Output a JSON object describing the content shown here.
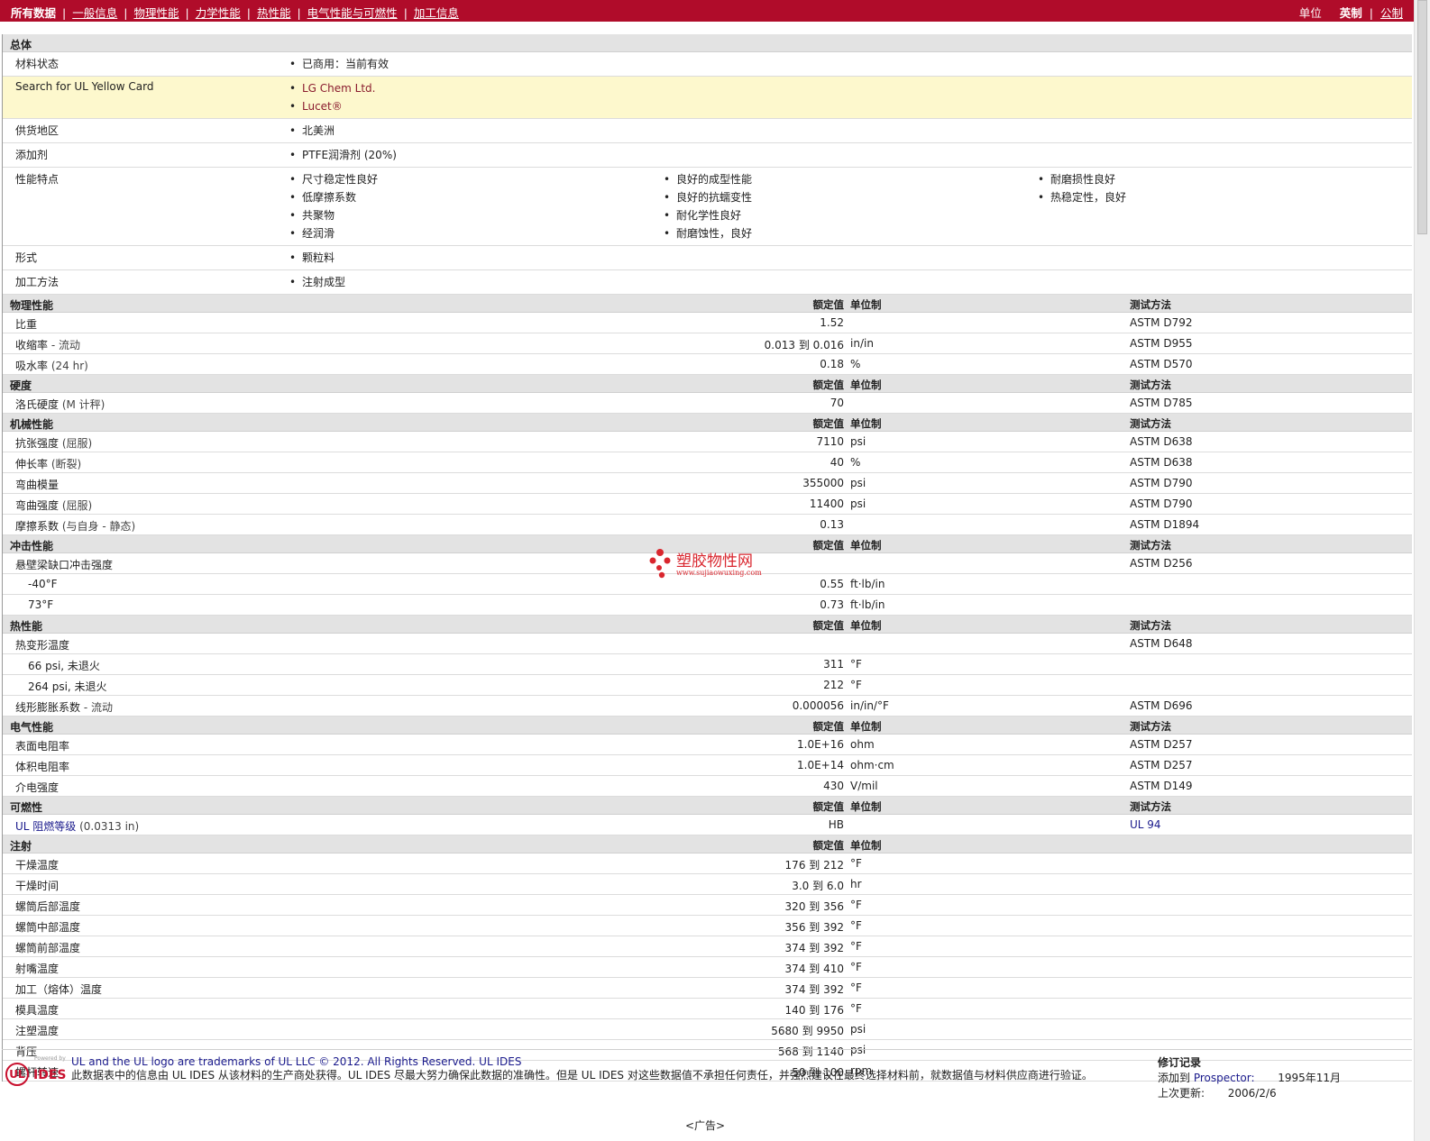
{
  "nav": {
    "tabs": [
      "所有数据",
      "一般信息",
      "物理性能",
      "力学性能",
      "热性能",
      "电气性能与可燃性",
      "加工信息"
    ],
    "units_label": "单位",
    "units": [
      "英制",
      "公制"
    ]
  },
  "general": [
    {
      "label": "总体",
      "type": "section"
    },
    {
      "label": "材料状态",
      "items": [
        [
          "已商用：当前有效"
        ]
      ]
    },
    {
      "label": "Search for UL Yellow Card",
      "highlight": true,
      "link_items": true,
      "items": [
        [
          "LG Chem Ltd.",
          "Lucet®"
        ]
      ]
    },
    {
      "label": "供货地区",
      "items": [
        [
          "北美洲"
        ]
      ]
    },
    {
      "label": "添加剂",
      "items": [
        [
          "PTFE润滑剂 (20%)"
        ]
      ]
    },
    {
      "label": "性能特点",
      "items": [
        [
          "尺寸稳定性良好",
          "低摩擦系数",
          "共聚物",
          "经润滑"
        ],
        [
          "良好的成型性能",
          "良好的抗蠕变性",
          "耐化学性良好",
          "耐磨蚀性，良好"
        ],
        [
          "耐磨损性良好",
          "热稳定性，良好"
        ]
      ]
    },
    {
      "label": "形式",
      "items": [
        [
          "颗粒料"
        ]
      ]
    },
    {
      "label": "加工方法",
      "items": [
        [
          "注射成型"
        ]
      ]
    }
  ],
  "headers": {
    "value": "额定值",
    "unit": "单位制",
    "test": "测试方法"
  },
  "sections": [
    {
      "name": "物理性能",
      "show_test_header": true,
      "rows": [
        {
          "label": "比重",
          "value": "1.52",
          "unit": "",
          "test": "ASTM D792"
        },
        {
          "label": "收缩率",
          "note": " - 流动",
          "value": "0.013 到  0.016",
          "unit": "in/in",
          "test": "ASTM D955"
        },
        {
          "label": "吸水率",
          "note": " (24 hr)",
          "value": "0.18",
          "unit": "%",
          "test": "ASTM D570"
        }
      ]
    },
    {
      "name": "硬度",
      "show_test_header": true,
      "rows": [
        {
          "label": "洛氏硬度",
          "note": " (M 计秤)",
          "value": "70",
          "unit": "",
          "test": "ASTM D785"
        }
      ]
    },
    {
      "name": "机械性能",
      "show_test_header": true,
      "rows": [
        {
          "label": "抗张强度",
          "note": " (屈服)",
          "value": "7110",
          "unit": "psi",
          "test": "ASTM D638"
        },
        {
          "label": "伸长率",
          "note": " (断裂)",
          "value": "40",
          "unit": "%",
          "test": "ASTM D638"
        },
        {
          "label": "弯曲模量",
          "value": "355000",
          "unit": "psi",
          "test": "ASTM D790"
        },
        {
          "label": "弯曲强度",
          "note": " (屈服)",
          "value": "11400",
          "unit": "psi",
          "test": "ASTM D790"
        },
        {
          "label": "摩擦系数",
          "note": " (与自身  - 静态)",
          "value": "0.13",
          "unit": "",
          "test": "ASTM D1894"
        }
      ]
    },
    {
      "name": "冲击性能",
      "show_test_header": true,
      "rows": [
        {
          "label": "悬壁梁缺口冲击强度",
          "value": "",
          "unit": "",
          "test": "ASTM D256"
        },
        {
          "label": "-40°F",
          "sub": true,
          "value": "0.55",
          "unit": "ft·lb/in",
          "test": ""
        },
        {
          "label": "73°F",
          "sub": true,
          "value": "0.73",
          "unit": "ft·lb/in",
          "test": ""
        }
      ]
    },
    {
      "name": "热性能",
      "show_test_header": true,
      "rows": [
        {
          "label": "热变形温度",
          "value": "",
          "unit": "",
          "test": "ASTM D648"
        },
        {
          "label": "66 psi, 未退火",
          "sub": true,
          "value": "311",
          "unit": "°F",
          "test": ""
        },
        {
          "label": "264 psi, 未退火",
          "sub": true,
          "value": "212",
          "unit": "°F",
          "test": ""
        },
        {
          "label": "线形膨胀系数",
          "note": " - 流动",
          "value": "0.000056",
          "unit": "in/in/°F",
          "test": "ASTM D696"
        }
      ]
    },
    {
      "name": "电气性能",
      "show_test_header": true,
      "rows": [
        {
          "label": "表面电阻率",
          "value": "1.0E+16",
          "unit": "ohm",
          "test": "ASTM D257"
        },
        {
          "label": "体积电阻率",
          "value": "1.0E+14",
          "unit": "ohm·cm",
          "test": "ASTM D257"
        },
        {
          "label": "介电强度",
          "value": "430",
          "unit": "V/mil",
          "test": "ASTM D149"
        }
      ]
    },
    {
      "name": "可燃性",
      "show_test_header": true,
      "rows": [
        {
          "label": "UL 阻燃等级",
          "note": " (0.0313 in)",
          "link": true,
          "value": "HB",
          "unit": "",
          "test": "UL 94",
          "test_link": true
        }
      ]
    },
    {
      "name": "注射",
      "show_test_header": false,
      "rows": [
        {
          "label": "干燥温度",
          "value": "176 到  212",
          "unit": "°F",
          "test": ""
        },
        {
          "label": "干燥时间",
          "value": "3.0 到  6.0",
          "unit": "hr",
          "test": ""
        },
        {
          "label": "螺筒后部温度",
          "value": "320 到  356",
          "unit": "°F",
          "test": ""
        },
        {
          "label": "螺筒中部温度",
          "value": "356 到  392",
          "unit": "°F",
          "test": ""
        },
        {
          "label": "螺筒前部温度",
          "value": "374 到  392",
          "unit": "°F",
          "test": ""
        },
        {
          "label": "射嘴温度",
          "value": "374 到  410",
          "unit": "°F",
          "test": ""
        },
        {
          "label": "加工（熔体）温度",
          "value": "374 到  392",
          "unit": "°F",
          "test": ""
        },
        {
          "label": "模具温度",
          "value": "140 到  176",
          "unit": "°F",
          "test": ""
        },
        {
          "label": "注塑温度",
          "value": "5680 到  9950",
          "unit": "psi",
          "test": ""
        },
        {
          "label": "背压",
          "value": "568 到  1140",
          "unit": "psi",
          "test": ""
        },
        {
          "label": "螺杆转速",
          "value": "50 到  100",
          "unit": "rpm",
          "test": ""
        }
      ]
    }
  ],
  "watermark": {
    "title": "塑胶物性网",
    "url": "www.sujiaowuxing.com"
  },
  "footer": {
    "logo_powered": "Powered by",
    "logo_ul": "UL",
    "logo_ides": "IDES",
    "trademark": "UL and the UL logo are trademarks of UL LLC © 2012. All Rights Reserved. UL IDES",
    "disclaimer": "此数据表中的信息由  UL IDES 从该材料的生产商处获得。UL IDES 尽最大努力确保此数据的准确性。但是  UL IDES 对这些数据值不承担任何责任，并强烈建议在最终选择材料前，就数据值与材料供应商进行验证。",
    "revision_title": "修订记录",
    "added_label": "添加到",
    "added_source": "Prospector:",
    "added_date": "1995年11月",
    "updated_label": "上次更新:",
    "updated_date": "2006/2/6"
  },
  "ad_label": "<广告>",
  "colors": {
    "topbar": "#b00c2a",
    "highlight": "#fdf8cd",
    "section": "#e3e3e3",
    "link": "#8a1c2e"
  }
}
